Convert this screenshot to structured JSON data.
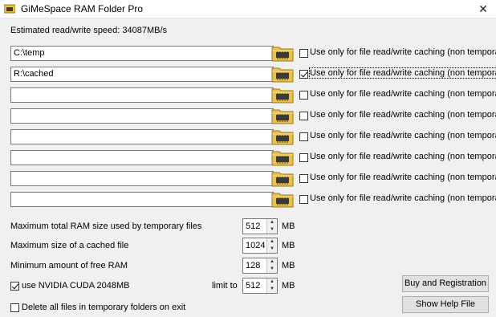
{
  "window": {
    "title": "GiMeSpace RAM Folder Pro",
    "close_glyph": "✕"
  },
  "speed_text": "Estimated read/write speed: 34087MB/s",
  "folders": [
    {
      "path": "C:\\temp",
      "cache_label": "Use only for file read/write caching (non temporary)",
      "checked": false
    },
    {
      "path": "R:\\cached",
      "cache_label": "Use only for file read/write caching (non temporary)",
      "checked": true
    },
    {
      "path": "",
      "cache_label": "Use only for file read/write caching (non temporary)",
      "checked": false
    },
    {
      "path": "",
      "cache_label": "Use only for file read/write caching (non temporary)",
      "checked": false
    },
    {
      "path": "",
      "cache_label": "Use only for file read/write caching (non temporary)",
      "checked": false
    },
    {
      "path": "",
      "cache_label": "Use only for file read/write caching (non temporary)",
      "checked": false
    },
    {
      "path": "",
      "cache_label": "Use only for file read/write caching (non temporary)",
      "checked": false
    },
    {
      "path": "",
      "cache_label": "Use only for file read/write caching (non temporary)",
      "checked": false
    }
  ],
  "settings": {
    "max_ram": {
      "label": "Maximum total RAM size used by temporary files",
      "value": "512",
      "unit": "MB"
    },
    "max_cached": {
      "label": "Maximum size of a cached file",
      "value": "1024",
      "unit": "MB"
    },
    "min_free": {
      "label": "Minimum amount of free RAM",
      "value": "128",
      "unit": "MB"
    },
    "cuda": {
      "label": "use NVIDIA CUDA 2048MB",
      "checked": true,
      "limit_label": "limit to",
      "value": "512",
      "unit": "MB"
    },
    "delete_on_exit": {
      "label": "Delete all files in temporary folders on exit",
      "checked": false
    }
  },
  "buttons": {
    "buy": "Buy and Registration",
    "help": "Show Help File"
  },
  "colors": {
    "folder_yellow": "#e8c24a",
    "chip_dark": "#3a3a3a",
    "title_bg": "#ffffff",
    "client_bg": "#f0f0f0"
  }
}
